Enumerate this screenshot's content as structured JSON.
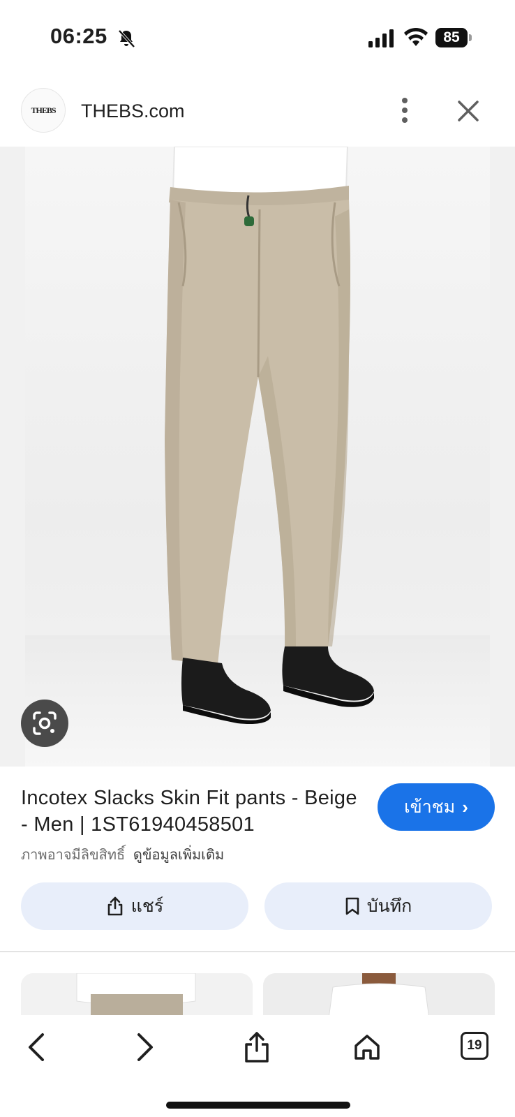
{
  "status_bar": {
    "time": "06:25",
    "battery": "85",
    "icons": [
      "bell-off-icon",
      "cellular-signal-icon",
      "wifi-icon",
      "battery-icon"
    ]
  },
  "source": {
    "logo_text": "THEBS",
    "site_name": "THEBS.com",
    "more_icon": "vertical-dots-icon",
    "close_icon": "close-icon"
  },
  "image": {
    "subject": "product-photo",
    "lens_icon": "google-lens-icon"
  },
  "product": {
    "title": "Incotex Slacks Skin Fit pants - Beige - Men | 1ST61940458501",
    "visit_label": "เข้าชม",
    "copyright_text": "ภาพอาจมีลิขสิทธิ์",
    "learn_more_link": "ดูข้อมูลเพิ่มเติม"
  },
  "actions": {
    "share_label": "แชร์",
    "save_label": "บันทึก"
  },
  "toolbar": {
    "tab_count": "19",
    "items": [
      "back-icon",
      "forward-icon",
      "share-icon",
      "home-icon",
      "tabs-icon"
    ]
  },
  "colors": {
    "accent": "#1a73e8",
    "action_bg": "#e8eefa",
    "pants": "#c9bda8",
    "shirt": "#ffffff",
    "shoes": "#1b1b1b"
  }
}
